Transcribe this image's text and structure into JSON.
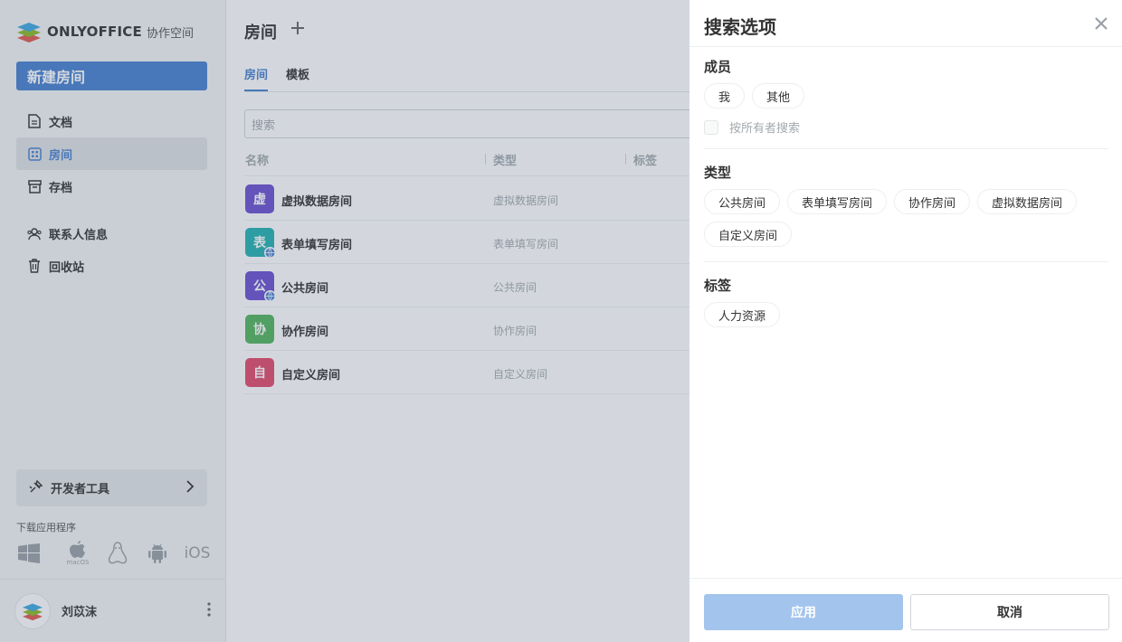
{
  "app": {
    "brand": "ONLYOFFICE",
    "product": "协作空间"
  },
  "sidebar": {
    "new_room_label": "新建房间",
    "items": [
      {
        "label": "文档",
        "icon": "document-icon"
      },
      {
        "label": "房间",
        "icon": "rooms-grid-icon",
        "active": true
      },
      {
        "label": "存档",
        "icon": "archive-icon"
      },
      {
        "label": "联系人信息",
        "icon": "contacts-icon"
      },
      {
        "label": "回收站",
        "icon": "trash-icon"
      }
    ],
    "dev_tools_label": "开发者工具",
    "download_label": "下载应用程序",
    "platforms": [
      "windows-icon",
      "macos-icon",
      "linux-icon",
      "android-icon",
      "ios-icon"
    ],
    "macos_caption": "macOS",
    "ios_label": "iOS",
    "user_name": "刘苡沫"
  },
  "main": {
    "title": "房间",
    "tabs": [
      {
        "label": "房间",
        "active": true
      },
      {
        "label": "模板",
        "active": false
      }
    ],
    "search_placeholder": "搜索",
    "columns": {
      "name": "名称",
      "type": "类型",
      "tags": "标签"
    },
    "rows": [
      {
        "initial": "虚",
        "name": "虚拟数据房间",
        "type": "虚拟数据房间",
        "color": "#6a4fd0",
        "public": false
      },
      {
        "initial": "表",
        "name": "表单填写房间",
        "type": "表单填写房间",
        "color": "#23b2b2",
        "public": true
      },
      {
        "initial": "公",
        "name": "公共房间",
        "type": "公共房间",
        "color": "#6a4fd0",
        "public": true
      },
      {
        "initial": "协",
        "name": "协作房间",
        "type": "协作房间",
        "color": "#53b55c",
        "public": false
      },
      {
        "initial": "自",
        "name": "自定义房间",
        "type": "自定义房间",
        "color": "#e3486a",
        "public": false
      }
    ]
  },
  "filter_panel": {
    "title": "搜索选项",
    "members": {
      "title": "成员",
      "chips": [
        "我",
        "其他"
      ],
      "search_by_owner": "按所有者搜索"
    },
    "type": {
      "title": "类型",
      "chips": [
        "公共房间",
        "表单填写房间",
        "协作房间",
        "虚拟数据房间",
        "自定义房间"
      ]
    },
    "tags": {
      "title": "标签",
      "chips": [
        "人力资源"
      ]
    },
    "apply_label": "应用",
    "cancel_label": "取消"
  },
  "colors": {
    "accent": "#4781d1",
    "apply_disabled": "#a3c4ec"
  }
}
